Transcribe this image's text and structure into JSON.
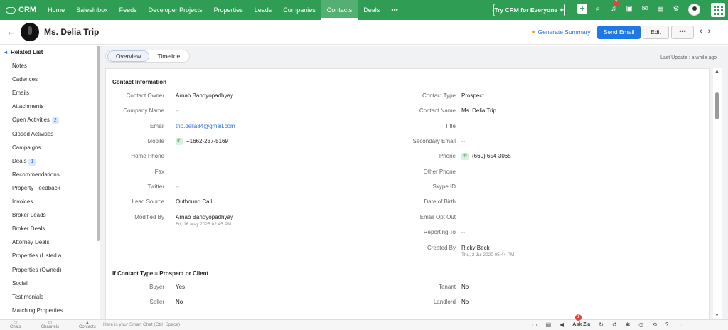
{
  "topbar": {
    "brand": "CRM",
    "nav": [
      "Home",
      "SalesInbox",
      "Feeds",
      "Developer Projects",
      "Properties",
      "Leads",
      "Companies",
      "Contacts",
      "Deals",
      "•••"
    ],
    "active_nav": "Contacts",
    "try_button": "Try CRM for Everyone ✦",
    "notification_count": "7",
    "accent": "#2f9e54"
  },
  "header": {
    "back": "←",
    "contact_name": "Ms. Delia Trip",
    "generate_summary": "Generate Summary",
    "send_email": "Send Email",
    "edit": "Edit",
    "more": "•••",
    "prev": "‹",
    "next": "›"
  },
  "sidebar": {
    "title": "Related List",
    "items": [
      {
        "label": "Notes",
        "count": ""
      },
      {
        "label": "Cadences",
        "count": ""
      },
      {
        "label": "Emails",
        "count": ""
      },
      {
        "label": "Attachments",
        "count": ""
      },
      {
        "label": "Open Activities",
        "count": "2"
      },
      {
        "label": "Closed Activities",
        "count": ""
      },
      {
        "label": "Campaigns",
        "count": ""
      },
      {
        "label": "Deals",
        "count": "1"
      },
      {
        "label": "Recommendations",
        "count": ""
      },
      {
        "label": "Property Feedback",
        "count": ""
      },
      {
        "label": "Invoices",
        "count": ""
      },
      {
        "label": "Broker Leads",
        "count": ""
      },
      {
        "label": "Broker Deals",
        "count": ""
      },
      {
        "label": "Attorney Deals",
        "count": ""
      },
      {
        "label": "Properties (Listed a...",
        "count": ""
      },
      {
        "label": "Properties (Owned)",
        "count": ""
      },
      {
        "label": "Social",
        "count": ""
      },
      {
        "label": "Testimonials",
        "count": ""
      },
      {
        "label": "Matching Properties",
        "count": ""
      }
    ]
  },
  "main": {
    "tabs": [
      "Overview",
      "Timeline"
    ],
    "last_update": "Last Update : a while ago",
    "section1_title": "Contact Information",
    "left_fields": [
      {
        "label": "Contact Owner",
        "value": "Arnab Bandyopadhyay"
      },
      {
        "label": "Company Name",
        "value": "--"
      },
      {
        "label": "Email",
        "value": "trip.delia84@gmail.com"
      },
      {
        "label": "Mobile",
        "value": "+1662-237-5169"
      },
      {
        "label": "Home Phone",
        "value": ""
      },
      {
        "label": "Fax",
        "value": ""
      },
      {
        "label": "Twitter",
        "value": "--"
      },
      {
        "label": "Lead Source",
        "value": "Outbound Call"
      },
      {
        "label": "Modified By",
        "value": "Arnab Bandyopadhyay",
        "sub": "Fri, 16 May 2025 02:45 PM"
      }
    ],
    "right_fields": [
      {
        "label": "Contact Type",
        "value": "Prospect"
      },
      {
        "label": "Contact Name",
        "value": "Ms. Delia Trip"
      },
      {
        "label": "Title",
        "value": ""
      },
      {
        "label": "Secondary Email",
        "value": "--"
      },
      {
        "label": "Phone",
        "value": "(660) 654-3065"
      },
      {
        "label": "Other Phone",
        "value": ""
      },
      {
        "label": "Skype ID",
        "value": ""
      },
      {
        "label": "Date of Birth",
        "value": ""
      },
      {
        "label": "Email Opt Out",
        "value": ""
      },
      {
        "label": "Reporting To",
        "value": "--"
      },
      {
        "label": "Created By",
        "value": "Ricky Beck",
        "sub": "Thu, 2 Jul 2020 05:44 PM"
      }
    ],
    "section2_title": "If Contact Type = Prospect or Client",
    "section2_left": [
      {
        "label": "Buyer",
        "value": "Yes"
      },
      {
        "label": "Seller",
        "value": "No"
      }
    ],
    "section2_right": [
      {
        "label": "Tenant",
        "value": "No"
      },
      {
        "label": "Landlord",
        "value": "No"
      }
    ]
  },
  "bottombar": {
    "left": [
      "Chats",
      "Channels",
      "Contacts"
    ],
    "smart_chat": "Here is your Smart Chat (Ctrl+Space)",
    "ask_zia": "Ask Zia",
    "badge": "1"
  }
}
